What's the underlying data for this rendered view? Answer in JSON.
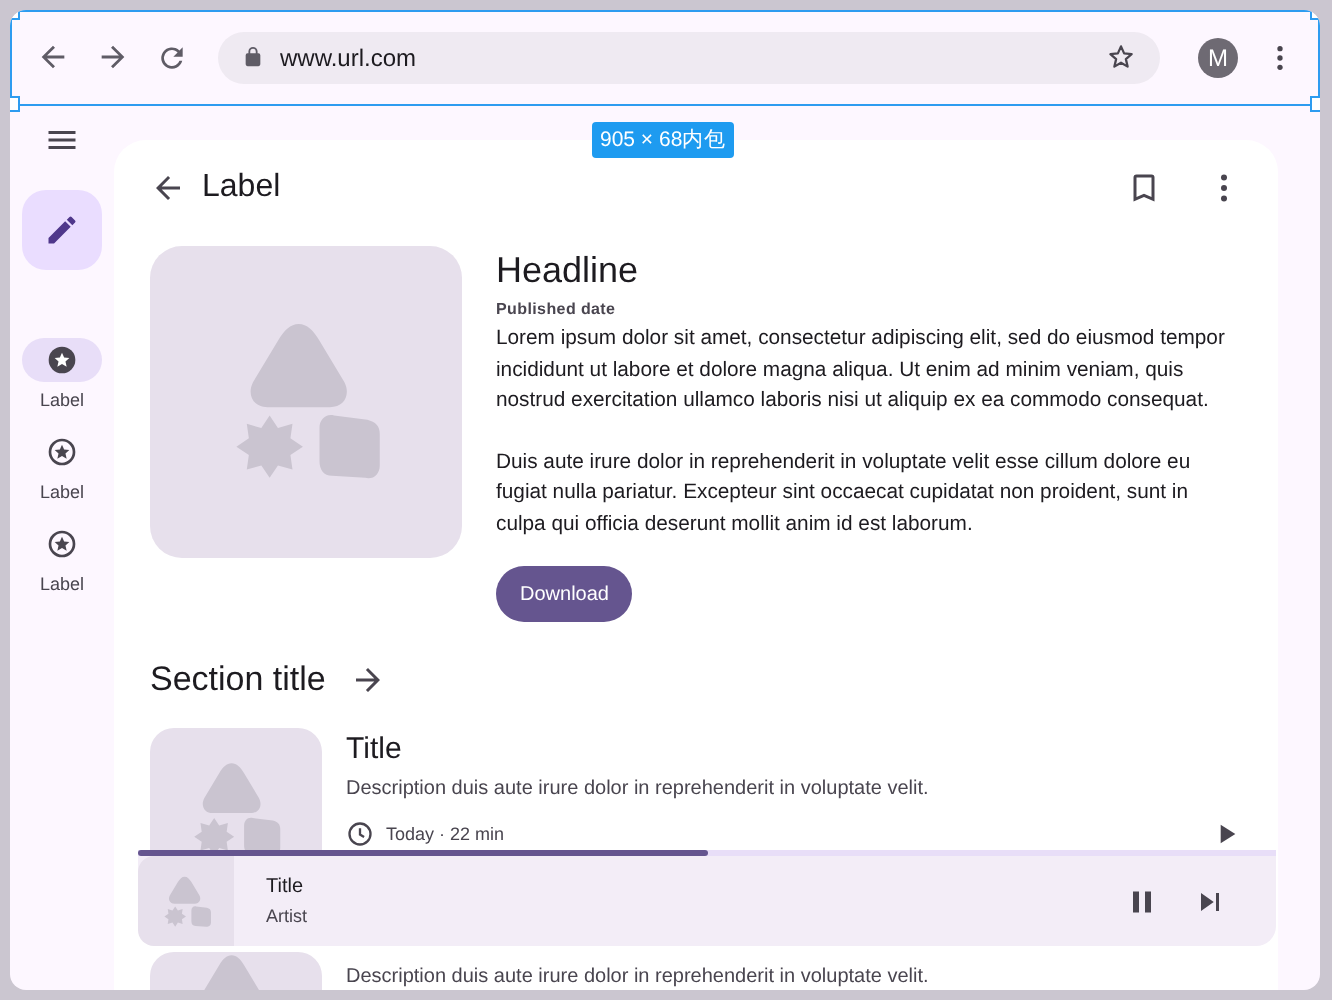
{
  "browser": {
    "url": "www.url.com",
    "avatar": "M"
  },
  "selection_badge": "905 × 68内包",
  "nav_rail": {
    "items": [
      {
        "label": "Label",
        "selected": true
      },
      {
        "label": "Label",
        "selected": false
      },
      {
        "label": "Label",
        "selected": false
      }
    ]
  },
  "top_bar": {
    "title": "Label"
  },
  "article": {
    "headline": "Headline",
    "published": "Published date",
    "paragraphs": [
      "Lorem ipsum dolor sit amet, consectetur adipiscing elit, sed do eiusmod tempor incididunt ut labore et dolore magna aliqua. Ut enim ad minim veniam, quis nostrud exercitation ullamco laboris nisi ut aliquip ex ea commodo consequat.",
      "Duis aute irure dolor in reprehenderit in voluptate velit esse cillum dolore eu fugiat nulla pariatur. Excepteur sint occaecat cupidatat non proident, sunt in culpa qui officia deserunt mollit anim id est laborum."
    ],
    "button": "Download"
  },
  "section": {
    "title": "Section title",
    "items": [
      {
        "title": "Title",
        "description": "Description duis aute irure dolor in reprehenderit in voluptate velit.",
        "meta": "Today · 22 min"
      },
      {
        "description": "Description duis aute irure dolor in reprehenderit in voluptate velit."
      }
    ]
  },
  "player": {
    "title": "Title",
    "artist": "Artist",
    "level": 0.5,
    "playing": true
  }
}
